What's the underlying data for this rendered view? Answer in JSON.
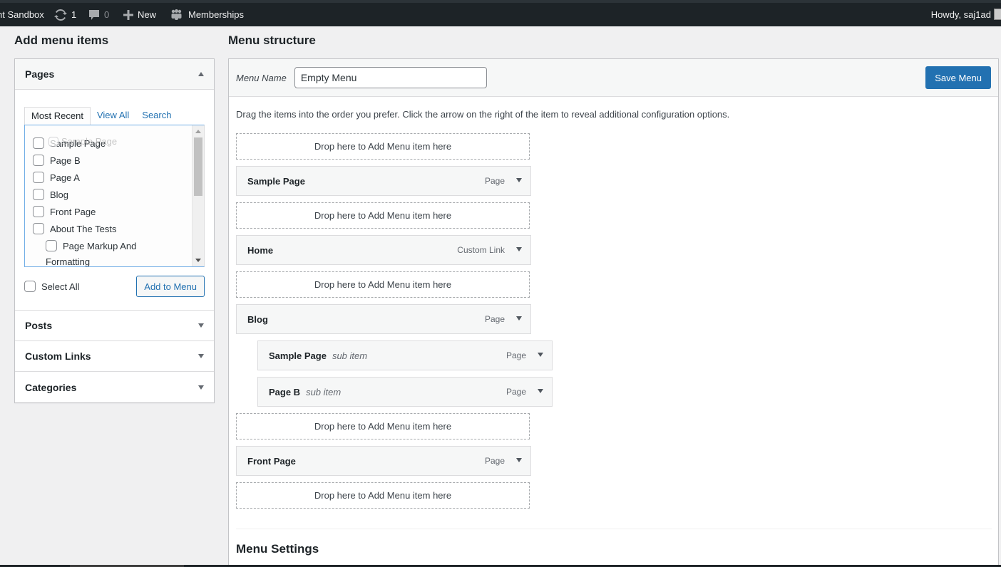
{
  "admin_bar": {
    "site_name": "nt Sandbox",
    "updates_count": "1",
    "comments_count": "0",
    "new_label": "New",
    "memberships_label": "Memberships",
    "howdy": "Howdy, saj1ad",
    "icons": {
      "updates": "refresh-icon",
      "comments": "comment-bubble-icon",
      "new": "plus-icon",
      "memberships": "group-icon",
      "avatar": "user-avatar"
    }
  },
  "left": {
    "title": "Add menu items",
    "pages_section": {
      "label": "Pages",
      "tabs": [
        {
          "label": "Most Recent",
          "active": true
        },
        {
          "label": "View All",
          "active": false
        },
        {
          "label": "Search",
          "active": false
        }
      ],
      "items": [
        {
          "label": "Sample Page",
          "level": 0,
          "checked": false
        },
        {
          "label": "Page B",
          "level": 0,
          "checked": false
        },
        {
          "label": "Page A",
          "level": 0,
          "checked": false
        },
        {
          "label": "Blog",
          "level": 0,
          "checked": false
        },
        {
          "label": "Front Page",
          "level": 0,
          "checked": false
        },
        {
          "label": "About The Tests",
          "level": 0,
          "checked": false
        },
        {
          "label": "Page Markup And",
          "label_wrap": "Formatting",
          "level": 1,
          "checked": false
        }
      ],
      "drag_ghost_label": "Sample Page",
      "select_all_label": "Select All",
      "add_button_label": "Add to Menu"
    },
    "collapsed_sections": [
      {
        "label": "Posts"
      },
      {
        "label": "Custom Links"
      },
      {
        "label": "Categories"
      }
    ]
  },
  "right": {
    "title": "Menu structure",
    "menu_name_label": "Menu Name",
    "menu_name_value": "Empty Menu",
    "save_button_label": "Save Menu",
    "instructions": "Drag the items into the order you prefer. Click the arrow on the right of the item to reveal additional configuration options.",
    "drop_zone_label": "Drop here to Add Menu item here",
    "menu_items": [
      {
        "title": "Sample Page",
        "type": "Page",
        "sub_label": "",
        "depth": 0
      },
      {
        "title": "Home",
        "type": "Custom Link",
        "sub_label": "",
        "depth": 0
      },
      {
        "title": "Blog",
        "type": "Page",
        "sub_label": "",
        "depth": 0
      },
      {
        "title": "Sample Page",
        "type": "Page",
        "sub_label": "sub item",
        "depth": 1
      },
      {
        "title": "Page B",
        "type": "Page",
        "sub_label": "sub item",
        "depth": 1
      },
      {
        "title": "Front Page",
        "type": "Page",
        "sub_label": "",
        "depth": 0
      }
    ],
    "settings_title": "Menu Settings"
  },
  "colors": {
    "admin_bar_bg": "#1d2327",
    "primary": "#2271b1",
    "page_bg": "#f0f0f1"
  }
}
